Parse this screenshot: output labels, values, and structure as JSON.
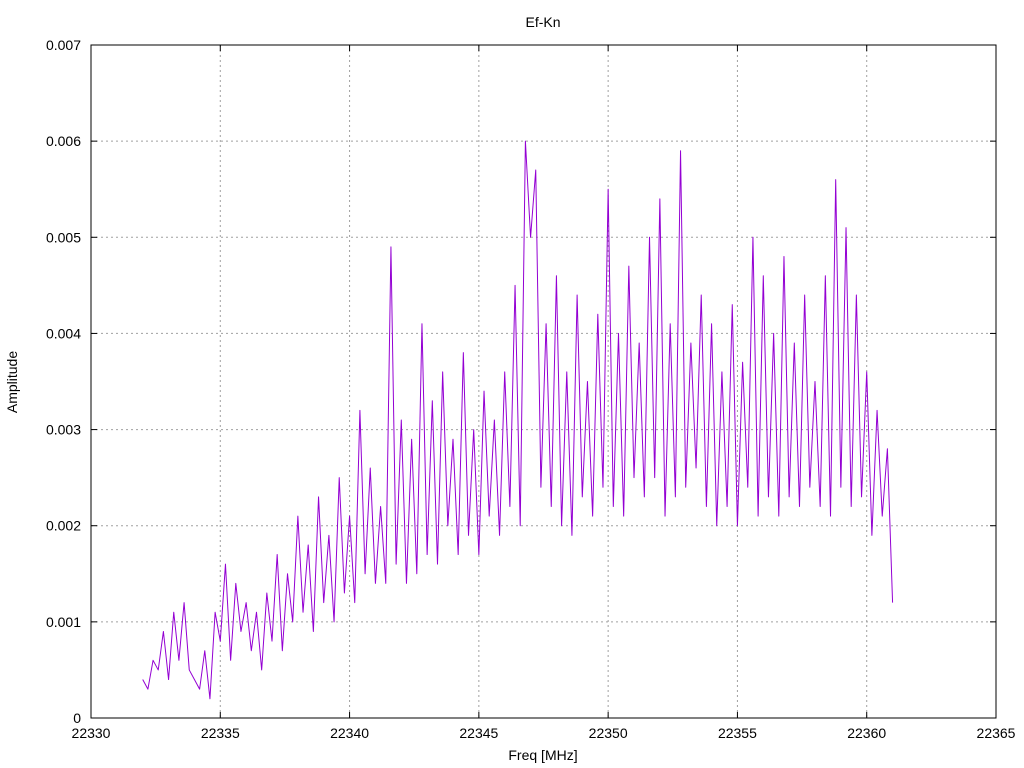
{
  "chart_data": {
    "type": "line",
    "title": "Ef-Kn",
    "xlabel": "Freq [MHz]",
    "ylabel": "Amplitude",
    "xlim": [
      22330,
      22365
    ],
    "ylim": [
      0,
      0.007
    ],
    "xticks": [
      "22330",
      "22335",
      "22340",
      "22345",
      "22350",
      "22355",
      "22360",
      "22365"
    ],
    "yticks": [
      "0",
      "0.001",
      "0.002",
      "0.003",
      "0.004",
      "0.005",
      "0.006",
      "0.007"
    ],
    "grid": true,
    "legend": "none",
    "series": [
      {
        "color": "#9400d3",
        "x_start": 22332.0,
        "x_step": 0.2,
        "values": [
          0.0004,
          0.0003,
          0.0006,
          0.0005,
          0.0009,
          0.0004,
          0.0011,
          0.0006,
          0.0012,
          0.0005,
          0.0004,
          0.0003,
          0.0007,
          0.0002,
          0.0011,
          0.0008,
          0.0016,
          0.0006,
          0.0014,
          0.0009,
          0.0012,
          0.0007,
          0.0011,
          0.0005,
          0.0013,
          0.0008,
          0.0017,
          0.0007,
          0.0015,
          0.001,
          0.0021,
          0.0011,
          0.0018,
          0.0009,
          0.0023,
          0.0012,
          0.0019,
          0.001,
          0.0025,
          0.0013,
          0.0021,
          0.0012,
          0.0032,
          0.0015,
          0.0026,
          0.0014,
          0.0022,
          0.0014,
          0.0049,
          0.0016,
          0.0031,
          0.0014,
          0.0029,
          0.0015,
          0.0041,
          0.0017,
          0.0033,
          0.0016,
          0.0036,
          0.002,
          0.0029,
          0.0017,
          0.0038,
          0.0019,
          0.003,
          0.0017,
          0.0034,
          0.0021,
          0.0031,
          0.0019,
          0.0036,
          0.0022,
          0.0045,
          0.002,
          0.006,
          0.005,
          0.0057,
          0.0024,
          0.0041,
          0.0022,
          0.0046,
          0.002,
          0.0036,
          0.0019,
          0.0044,
          0.0023,
          0.0035,
          0.0021,
          0.0042,
          0.0024,
          0.0055,
          0.0022,
          0.004,
          0.0021,
          0.0047,
          0.0025,
          0.0039,
          0.0023,
          0.005,
          0.0025,
          0.0054,
          0.0021,
          0.0041,
          0.0023,
          0.0059,
          0.0024,
          0.0039,
          0.0026,
          0.0044,
          0.0022,
          0.0041,
          0.002,
          0.0036,
          0.0022,
          0.0043,
          0.002,
          0.0037,
          0.0024,
          0.005,
          0.0021,
          0.0046,
          0.0023,
          0.004,
          0.0021,
          0.0048,
          0.0023,
          0.0039,
          0.0022,
          0.0044,
          0.0024,
          0.0035,
          0.0022,
          0.0046,
          0.0021,
          0.0056,
          0.0024,
          0.0051,
          0.0022,
          0.0044,
          0.0023,
          0.0036,
          0.0019,
          0.0032,
          0.0021,
          0.0028,
          0.0012
        ]
      }
    ]
  }
}
